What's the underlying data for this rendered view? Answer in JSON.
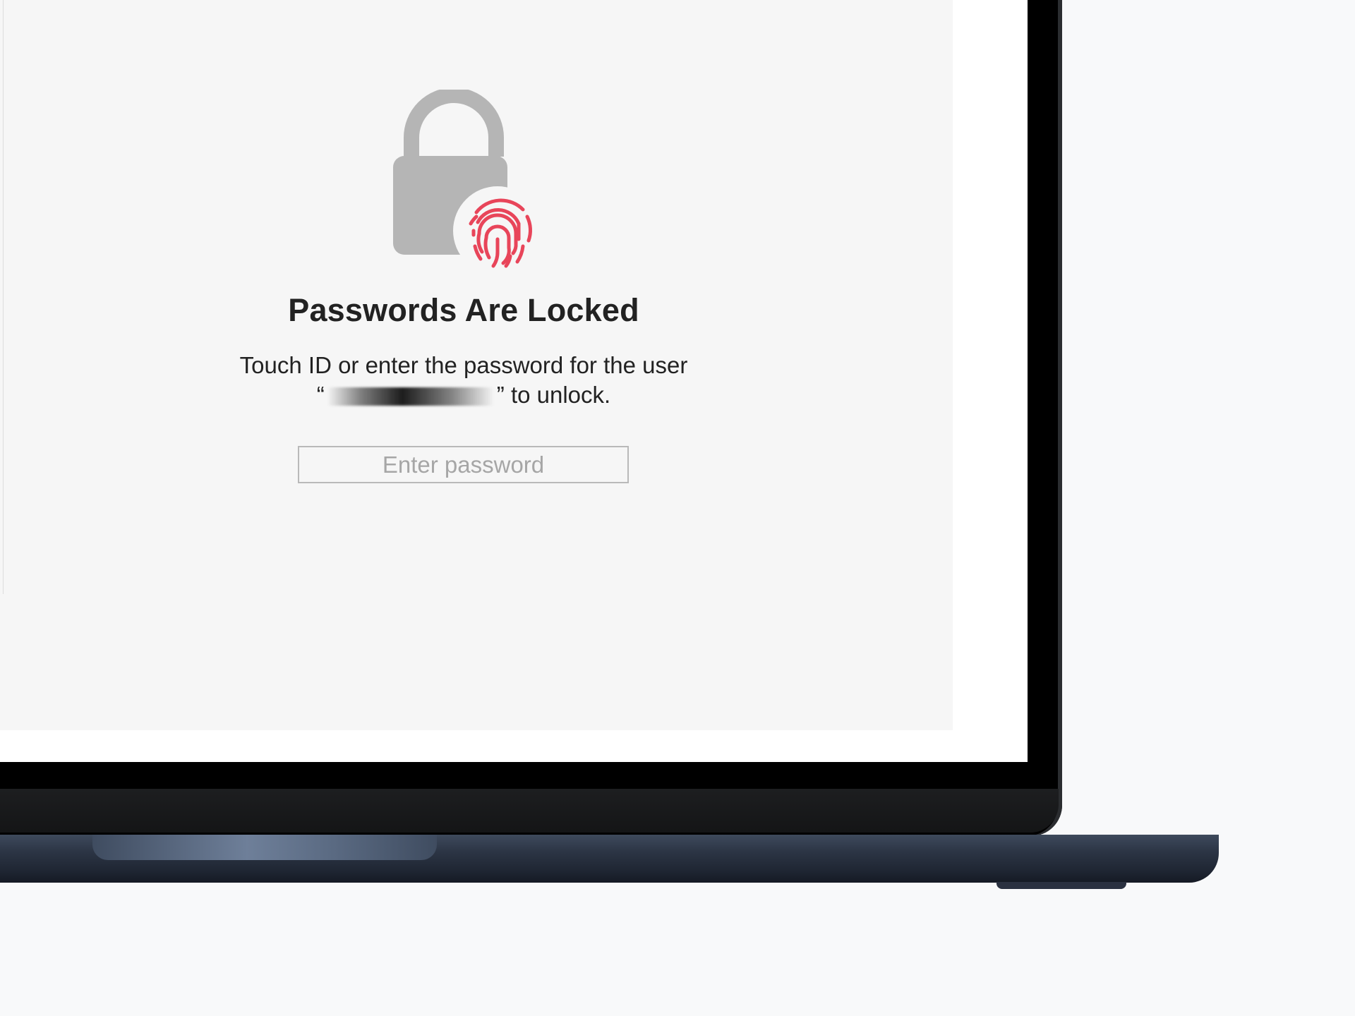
{
  "lock_screen": {
    "title": "Passwords Are Locked",
    "message_line1": "Touch ID or enter the password for the user",
    "message_open_quote": "“",
    "message_close_quote": "” to unlock.",
    "password_placeholder": "Enter password"
  },
  "icons": {
    "lock": "lock-icon",
    "fingerprint": "fingerprint-icon"
  },
  "colors": {
    "fingerprint": "#e8455a",
    "lock": "#b5b5b5",
    "window_background": "#f6f6f6",
    "laptop_base": "#2c3545"
  }
}
